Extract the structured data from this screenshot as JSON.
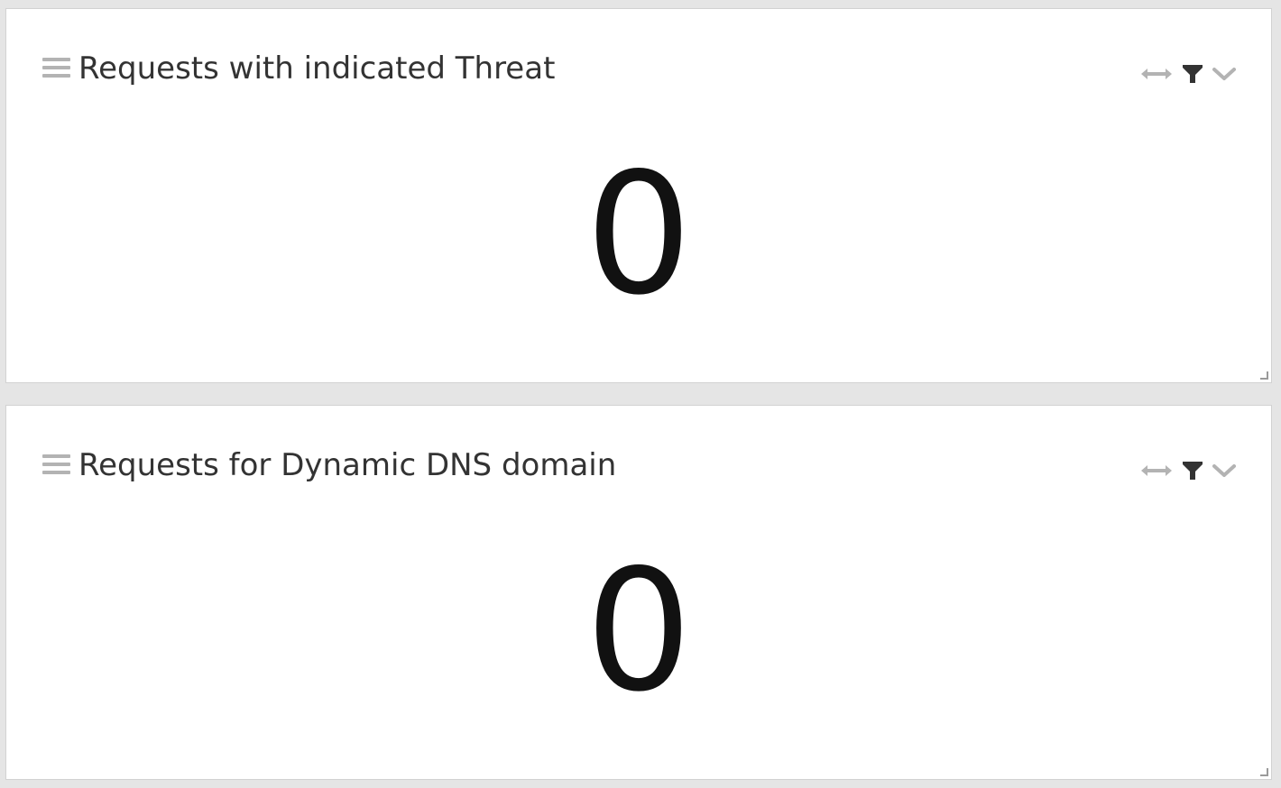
{
  "widgets": [
    {
      "title": "Requests with indicated Threat",
      "value": "0",
      "icons": [
        "drag-handle-icon",
        "expand-horizontal-icon",
        "filter-icon",
        "chevron-down-icon",
        "resize-grip-icon"
      ]
    },
    {
      "title": "Requests for Dynamic DNS domain",
      "value": "0",
      "icons": [
        "drag-handle-icon",
        "expand-horizontal-icon",
        "filter-icon",
        "chevron-down-icon",
        "resize-grip-icon"
      ]
    }
  ],
  "colors": {
    "background": "#e5e5e5",
    "panel": "#ffffff",
    "panel_border": "#d2d2d2",
    "title_text": "#333333",
    "value_text": "#111111",
    "icon_muted": "#b3b3b3",
    "icon_active": "#333333"
  }
}
